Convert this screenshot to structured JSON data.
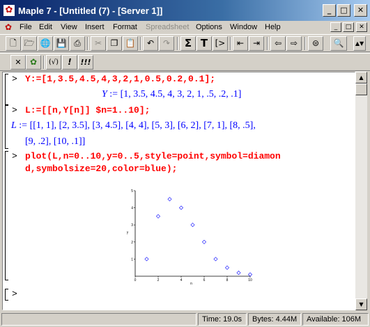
{
  "window": {
    "title": "Maple 7  - [Untitled (7) - [Server 1]]",
    "app_icon": "maple-leaf-icon",
    "minimize_glyph": "_",
    "maximize_glyph": "□",
    "close_glyph": "✕"
  },
  "menu": {
    "items": [
      "File",
      "Edit",
      "View",
      "Insert",
      "Format",
      "Spreadsheet",
      "Options",
      "Window",
      "Help"
    ],
    "disabled": [
      "Spreadsheet"
    ],
    "doc_icon": "document-icon",
    "mdi_buttons": [
      "_",
      "□",
      "✕"
    ]
  },
  "toolbar1": {
    "buttons": [
      {
        "name": "new-icon",
        "glyph": "🗋"
      },
      {
        "name": "open-icon",
        "glyph": "🗁"
      },
      {
        "name": "open-url-icon",
        "glyph": "🌐"
      },
      {
        "name": "save-icon",
        "glyph": "💾"
      },
      {
        "name": "print-icon",
        "glyph": "⎙"
      },
      {
        "name": "cut-icon",
        "glyph": "✂"
      },
      {
        "name": "copy-icon",
        "glyph": "❐"
      },
      {
        "name": "paste-icon",
        "glyph": "📋"
      },
      {
        "name": "undo-icon",
        "glyph": "↶"
      },
      {
        "name": "redo-icon",
        "glyph": "↷"
      },
      {
        "name": "sigma-icon",
        "glyph": "Σ"
      },
      {
        "name": "text-icon",
        "glyph": "T"
      },
      {
        "name": "input-icon",
        "glyph": "[>"
      },
      {
        "name": "outdent-icon",
        "glyph": "⇤"
      },
      {
        "name": "indent-icon",
        "glyph": "⇥"
      },
      {
        "name": "back-arrow-icon",
        "glyph": "⇦"
      },
      {
        "name": "forward-arrow-icon",
        "glyph": "⇨"
      },
      {
        "name": "stop-icon",
        "glyph": "⊜"
      },
      {
        "name": "magnify-icon",
        "glyph": "🔍"
      }
    ],
    "gray_buttons": [
      "cut-icon",
      "redo-icon"
    ]
  },
  "toolbar2": {
    "buttons": [
      {
        "name": "close-x-icon",
        "glyph": "✕"
      },
      {
        "name": "maple-leaf-exec-icon",
        "glyph": "✿"
      },
      {
        "name": "check-icon",
        "glyph": "(√)"
      },
      {
        "name": "exclaim-icon",
        "glyph": "!"
      },
      {
        "name": "triple-exclaim-icon",
        "glyph": "!!!"
      }
    ]
  },
  "worksheet": {
    "prompt": ">",
    "inputs": [
      "Y:=[1,3.5,4.5,4,3,2,1,0.5,0.2,0.1];",
      "L:=[[n,Y[n]] $n=1..10];",
      "plot(L,n=0..10,y=0..5,style=point,symbol=diamon",
      "d,symbolsize=20,color=blue);"
    ],
    "output1_lhs": "Y",
    "output1_rhs": " := [1, 3.5, 4.5, 4, 3, 2, 1, .5, .2, .1]",
    "output2_lhs": "L",
    "output2_line1": " := [[1, 1], [2, 3.5], [3, 4.5], [4, 4], [5, 3], [6, 2], [7, 1], [8, .5],",
    "output2_line2": "[9, .2], [10, .1]]"
  },
  "chart_data": {
    "type": "scatter",
    "x": [
      1,
      2,
      3,
      4,
      5,
      6,
      7,
      8,
      9,
      10
    ],
    "y": [
      1,
      3.5,
      4.5,
      4,
      3,
      2,
      1,
      0.5,
      0.2,
      0.1
    ],
    "xlabel": "n",
    "ylabel": "y",
    "xlim": [
      0,
      10
    ],
    "ylim": [
      0,
      5
    ],
    "xticks": [
      "0",
      "2",
      "4",
      "6",
      "8",
      "10"
    ],
    "yticks": [
      "1",
      "2",
      "3",
      "4",
      "5"
    ],
    "marker": "diamond",
    "color": "#0000ff",
    "grid": false
  },
  "statusbar": {
    "time": "Time: 19.0s",
    "bytes": "Bytes: 4.44M",
    "available": "Available: 106M"
  }
}
